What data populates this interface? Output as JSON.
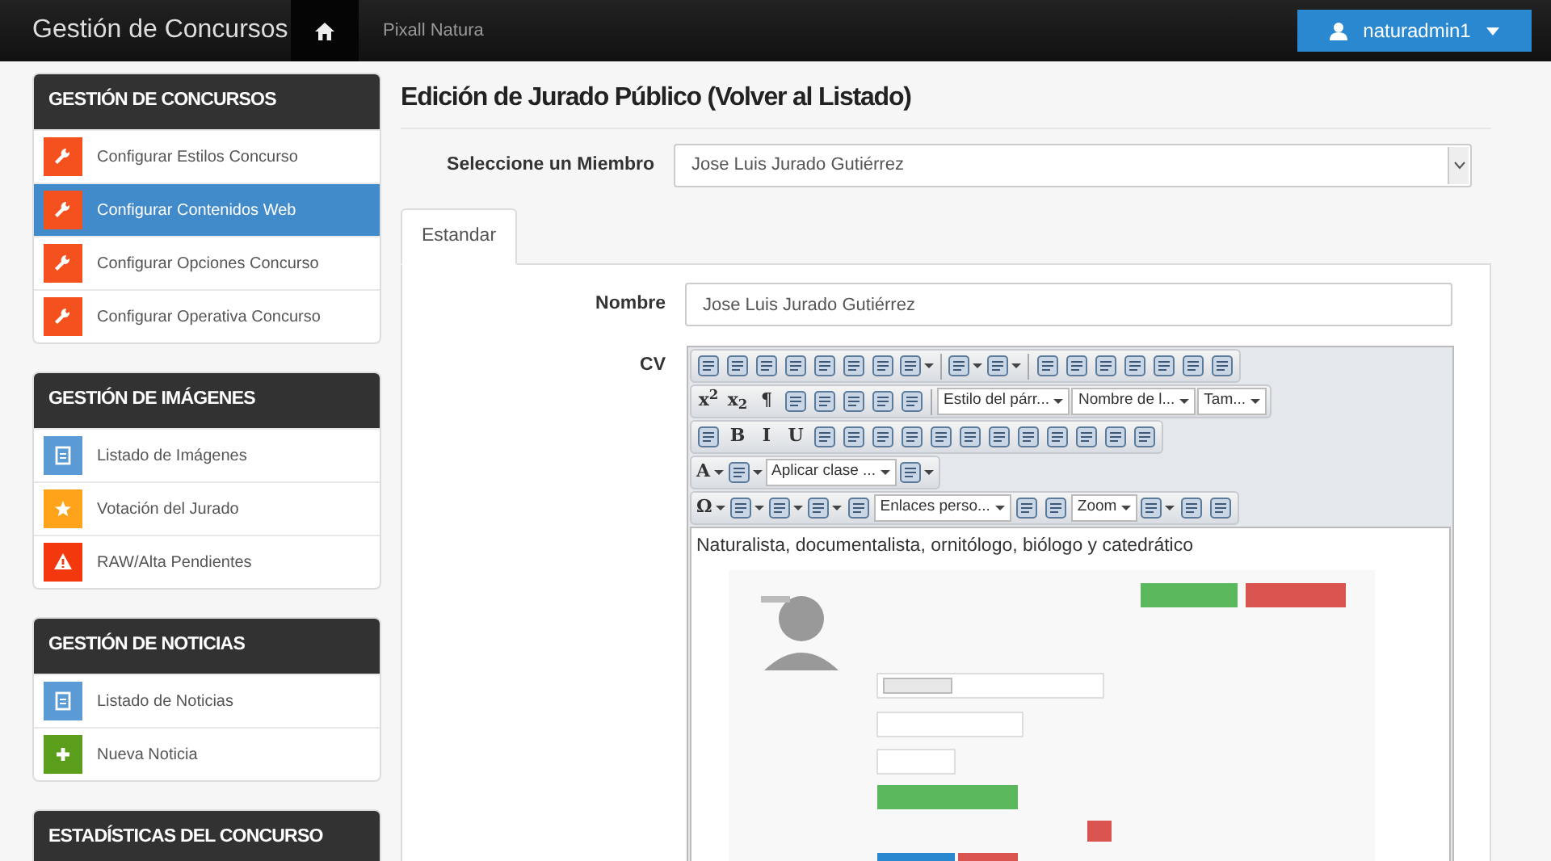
{
  "navbar": {
    "brand": "Gestión de Concursos",
    "site": "Pixall Natura",
    "user": "naturadmin1"
  },
  "sidebar": [
    {
      "title": "GESTIÓN DE CONCURSOS",
      "items": [
        {
          "label": "Configurar Estilos Concurso",
          "kind": "wrench",
          "color": "#f4511e",
          "selected": false
        },
        {
          "label": "Configurar Contenidos Web",
          "kind": "wrench",
          "color": "#f4511e",
          "selected": true
        },
        {
          "label": "Configurar Opciones Concurso",
          "kind": "wrench",
          "color": "#f4511e",
          "selected": false
        },
        {
          "label": "Configurar Operativa Concurso",
          "kind": "wrench",
          "color": "#f4511e",
          "selected": false
        }
      ]
    },
    {
      "title": "GESTIÓN DE IMÁGENES",
      "items": [
        {
          "label": "Listado de Imágenes",
          "kind": "document",
          "color": "#5b9bd5",
          "selected": false
        },
        {
          "label": "Votación del Jurado",
          "kind": "star",
          "color": "#ffa31a",
          "selected": false
        },
        {
          "label": "RAW/Alta Pendientes",
          "kind": "warning",
          "color": "#f4380e",
          "selected": false
        }
      ]
    },
    {
      "title": "GESTIÓN DE NOTICIAS",
      "items": [
        {
          "label": "Listado de Noticias",
          "kind": "document",
          "color": "#5b9bd5",
          "selected": false
        },
        {
          "label": "Nueva Noticia",
          "kind": "plus",
          "color": "#5a9e1c",
          "selected": false
        }
      ]
    },
    {
      "title": "ESTADÍSTICAS DEL CONCURSO"
    }
  ],
  "page": {
    "title": "Edición de Jurado Público (",
    "link": "Volver al Listado",
    "title_end": ")",
    "member_label": "Seleccione un Miembro",
    "member_value": "Jose Luis Jurado Gutiérrez"
  },
  "tabs": [
    {
      "label": "Estandar",
      "selected": true
    }
  ],
  "form": {
    "name_label": "Nombre",
    "name_value": "Jose Luis Jurado Gutiérrez",
    "cv_label": "CV"
  },
  "editor": {
    "toolbar": [
      [
        {
          "kind": "icon"
        },
        {
          "kind": "icon"
        },
        {
          "kind": "icon"
        },
        {
          "kind": "icon"
        },
        {
          "kind": "icon"
        },
        {
          "kind": "icon"
        },
        {
          "kind": "icon"
        },
        {
          "kind": "icon",
          "menu": true
        },
        {
          "kind": "sep"
        },
        {
          "kind": "icon",
          "menu": true
        },
        {
          "kind": "icon",
          "menu": true
        },
        {
          "kind": "sep"
        },
        {
          "kind": "icon"
        },
        {
          "kind": "icon"
        },
        {
          "kind": "icon"
        },
        {
          "kind": "icon"
        },
        {
          "kind": "icon"
        },
        {
          "kind": "icon"
        },
        {
          "kind": "icon"
        }
      ],
      [
        {
          "kind": "glyph",
          "label": "x$^{2}$"
        },
        {
          "kind": "glyph",
          "label": "x$_{2}$"
        },
        {
          "kind": "glyph",
          "label": "¶"
        },
        {
          "kind": "icon"
        },
        {
          "kind": "icon"
        },
        {
          "kind": "icon"
        },
        {
          "kind": "icon"
        },
        {
          "kind": "icon"
        },
        {
          "kind": "sep"
        },
        {
          "kind": "dropdown",
          "label": "Estilo del párr..."
        },
        {
          "kind": "dropdown",
          "label": "Nombre de l..."
        },
        {
          "kind": "dropdown",
          "label": "Tam..."
        }
      ],
      [
        {
          "kind": "icon"
        },
        {
          "kind": "glyph",
          "label": "B"
        },
        {
          "kind": "glyph",
          "label": "I"
        },
        {
          "kind": "glyph",
          "label": "U"
        },
        {
          "kind": "icon"
        },
        {
          "kind": "icon"
        },
        {
          "kind": "icon"
        },
        {
          "kind": "icon"
        },
        {
          "kind": "icon"
        },
        {
          "kind": "icon"
        },
        {
          "kind": "icon"
        },
        {
          "kind": "icon"
        },
        {
          "kind": "icon"
        },
        {
          "kind": "icon"
        },
        {
          "kind": "icon"
        },
        {
          "kind": "icon"
        }
      ],
      [
        {
          "kind": "glyph",
          "label": "A",
          "menu": true
        },
        {
          "kind": "icon",
          "menu": true
        },
        {
          "kind": "dropdown",
          "label": "Aplicar clase ..."
        },
        {
          "kind": "icon",
          "menu": true
        }
      ],
      [
        {
          "kind": "glyph",
          "label": "Ω",
          "menu": true
        },
        {
          "kind": "icon",
          "menu": true
        },
        {
          "kind": "icon",
          "menu": true
        },
        {
          "kind": "icon",
          "menu": true
        },
        {
          "kind": "icon"
        },
        {
          "kind": "dropdown",
          "label": "Enlaces perso..."
        },
        {
          "kind": "icon"
        },
        {
          "kind": "icon"
        },
        {
          "kind": "dropdown",
          "label": "Zoom"
        },
        {
          "kind": "icon",
          "menu": true
        },
        {
          "kind": "icon"
        },
        {
          "kind": "icon"
        }
      ]
    ],
    "text": "Naturalista, documentalista, ornitólogo, biólogo y catedrático"
  }
}
